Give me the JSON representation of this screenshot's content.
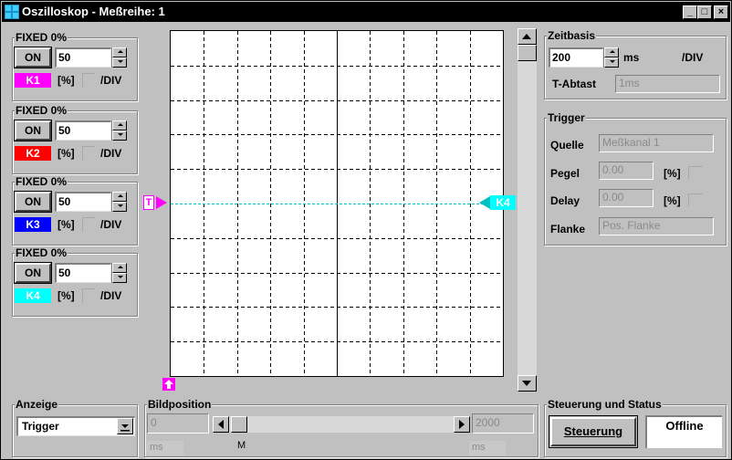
{
  "window": {
    "title": "Oszilloskop - Meßreihe: 1",
    "minimize": "_",
    "maximize": "□",
    "close": "×"
  },
  "channels": [
    {
      "group_label": "FIXED 0%",
      "on_label": "ON",
      "value": "50",
      "name": "K1",
      "color": "#ff00ff",
      "unit": "[%]",
      "per_div": "/DIV"
    },
    {
      "group_label": "FIXED 0%",
      "on_label": "ON",
      "value": "50",
      "name": "K2",
      "color": "#ff0000",
      "unit": "[%]",
      "per_div": "/DIV"
    },
    {
      "group_label": "FIXED 0%",
      "on_label": "ON",
      "value": "50",
      "name": "K3",
      "color": "#0000ff",
      "unit": "[%]",
      "per_div": "/DIV"
    },
    {
      "group_label": "FIXED 0%",
      "on_label": "ON",
      "value": "50",
      "name": "K4",
      "color": "#00ffff",
      "unit": "[%]",
      "per_div": "/DIV"
    }
  ],
  "scope": {
    "trigger_marker": "T",
    "channel_marker": "K4",
    "marker_color": "#ff00ff",
    "trace_color": "#00c0c0",
    "grid": true
  },
  "zeitbasis": {
    "label": "Zeitbasis",
    "value": "200",
    "unit": "ms",
    "per_div": "/DIV",
    "t_abtast_label": "T-Abtast",
    "t_abtast_value": "1ms"
  },
  "trigger": {
    "label": "Trigger",
    "quelle_label": "Quelle",
    "quelle_value": "Meßkanal 1",
    "pegel_label": "Pegel",
    "pegel_value": "0.00",
    "pegel_unit": "[%]",
    "delay_label": "Delay",
    "delay_value": "0.00",
    "delay_unit": "[%]",
    "flanke_label": "Flanke",
    "flanke_value": "Pos. Flanke"
  },
  "anzeige": {
    "label": "Anzeige",
    "selected": "Trigger"
  },
  "bildposition": {
    "label": "Bildposition",
    "start_value": "0",
    "end_value": "2000",
    "start_unit": "ms",
    "end_unit": "ms",
    "thumb_label": "M"
  },
  "steuerung": {
    "label": "Steuerung und Status",
    "button_label": "Steuerung",
    "status": "Offline"
  }
}
